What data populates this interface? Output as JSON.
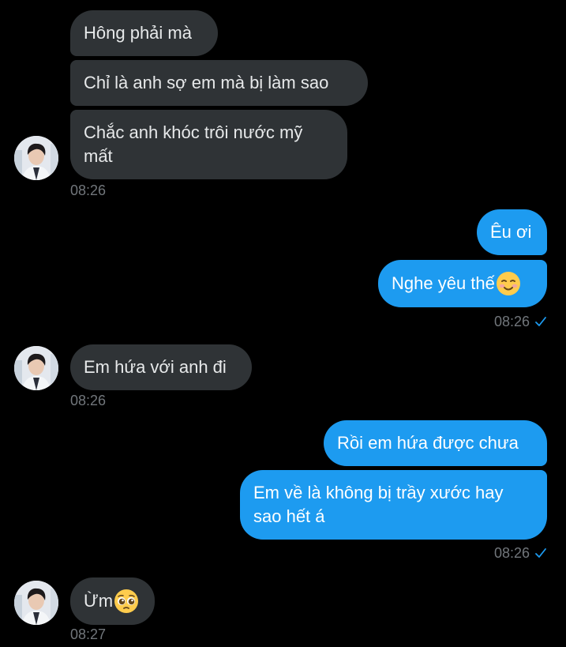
{
  "messages": {
    "m1": "Hông phải mà",
    "m2": "Chỉ là anh sợ em mà bị làm sao",
    "m3_line1": "Chắc anh khóc trôi nước mỹ",
    "m3_line2": "mất",
    "ts1": "08:26",
    "m4": "Êu ơi",
    "m5": "Nghe yêu thế",
    "ts2": "08:26",
    "m6": "Em hứa với anh đi",
    "ts3": "08:26",
    "m7": "Rồi em hứa được chưa",
    "m8_line1": "Em về là không bị trầy xước hay",
    "m8_line2": "sao hết á",
    "ts4": "08:26",
    "m9": "Ừm",
    "ts5": "08:27"
  },
  "colors": {
    "background": "#000000",
    "incoming_bubble": "#2f3336",
    "outgoing_bubble": "#1d9bf0",
    "timestamp": "#71767b",
    "read_check": "#1d9bf0"
  },
  "icons": {
    "read_receipt": "checkmark-icon",
    "avatar": "avatar",
    "emoji_smile": "smiling-face-icon",
    "emoji_pleading": "pleading-face-icon"
  }
}
